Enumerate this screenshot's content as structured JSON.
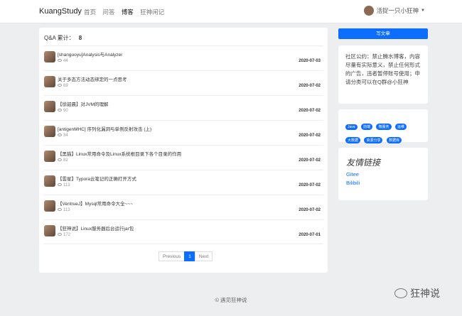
{
  "header": {
    "brand": "KuangStudy",
    "nav": [
      "首页",
      "问答",
      "博客",
      "狂神闲记"
    ],
    "user": "活捉一只小狂神"
  },
  "main": {
    "count_label": "Q&A 累计：",
    "count_value": "8",
    "posts": [
      {
        "title": "[shanguoyu]Analysis与Analyzer",
        "views": "44",
        "date": "2020-07-03"
      },
      {
        "title": "关于多态方法动态绑定的一点思考",
        "views": "69",
        "date": "2020-07-02"
      },
      {
        "title": "【徐韶晨】对JVM的理解",
        "views": "90",
        "date": "2020-07-02"
      },
      {
        "title": "[antigenMHC] 序列化漏洞与单例反射攻击 (上)",
        "views": "34",
        "date": "2020-07-02"
      },
      {
        "title": "【黑猫】Linux常用命令及Linux系统根目录下各个目录的作用",
        "views": "82",
        "date": "2020-07-02"
      },
      {
        "title": "【雲星】Typora云笔记的正确打开方式",
        "views": "113",
        "date": "2020-07-02"
      },
      {
        "title": "【VentrueJ】Mysql常用命令大全~~~",
        "views": "113",
        "date": "2020-07-02"
      },
      {
        "title": "【狂神说】Linux服务器后台运行jar包",
        "views": "172",
        "date": "2020-07-01"
      }
    ],
    "pager": {
      "prev": "Previous",
      "current": "1",
      "next": "Next"
    }
  },
  "sidebar": {
    "write_button": "写文章",
    "notice": "社区公约：禁止腾水博客，内容尽量有实际意义，禁止任何形式的广告，违者暂停账号使用；申请分类可以在Q群@小狂神",
    "tags": [
      "Java",
      "前端",
      "微服务",
      "运维",
      "大数据",
      "资源分享",
      "数据库"
    ],
    "links_title": "友情链接",
    "links": [
      "Gitee",
      "Bilibili"
    ]
  },
  "footer": {
    "text": "© 遇见狂神说",
    "watermark": "狂神说"
  }
}
